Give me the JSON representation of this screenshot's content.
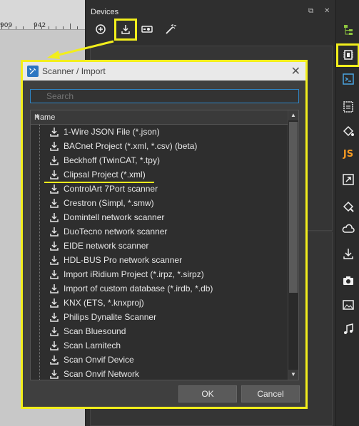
{
  "ruler": {
    "labels": [
      "909",
      "942"
    ]
  },
  "devices_panel": {
    "title": "Devices",
    "toolbar": [
      "add-icon",
      "import-icon",
      "device-settings-icon",
      "magic-wand-icon"
    ]
  },
  "right_toolbar": {
    "items": [
      "tree-icon",
      "device-chip-icon",
      "script-icon",
      "document-icon",
      "paint-bucket-icon",
      "js",
      "resize-icon",
      "drivers-icon",
      "cloud-icon",
      "download-icon",
      "camera-icon",
      "image-icon",
      "music-icon"
    ],
    "js_label": "JS"
  },
  "dialog": {
    "title": "Scanner / Import",
    "search_placeholder": "Search",
    "column_header": "Name",
    "items": [
      "1-Wire JSON File (*.json)",
      "BACnet Project (*.xml, *.csv) (beta)",
      "Beckhoff (TwinCAT, *.tpy)",
      "Clipsal Project (*.xml)",
      "ControlArt 7Port scanner",
      "Crestron (Simpl, *.smw)",
      "Domintell network scanner",
      "DuoTecno network scanner",
      "EIDE network scanner",
      "HDL-BUS Pro network scanner",
      "Import iRidium Project (*.irpz, *.sirpz)",
      "Import of custom database (*.irdb, *.db)",
      "KNX (ETS, *.knxproj)",
      "Philips Dynalite Scanner",
      "Scan Bluesound",
      "Scan Larnitech",
      "Scan Onvif Device",
      "Scan Onvif Network"
    ],
    "ok_label": "OK",
    "cancel_label": "Cancel"
  },
  "colors": {
    "highlight": "#f2ee1c",
    "accent": "#2f84c4"
  }
}
